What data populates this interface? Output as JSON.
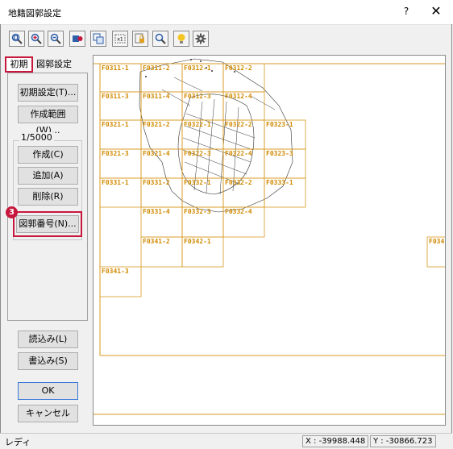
{
  "window": {
    "title": "地籍図郭設定",
    "help": "?",
    "close": "✕"
  },
  "toolbar": {
    "tools": [
      {
        "name": "zoom-extents-icon"
      },
      {
        "name": "zoom-in-icon"
      },
      {
        "name": "zoom-out-icon"
      },
      {
        "name": "layer-icon"
      },
      {
        "name": "copy-icon"
      },
      {
        "name": "scale-icon"
      },
      {
        "name": "lock-icon"
      },
      {
        "name": "find-icon"
      },
      {
        "name": "lightbulb-icon"
      },
      {
        "name": "gear-icon"
      }
    ]
  },
  "tabs": {
    "initial": "初期",
    "sheet": "図郭設定"
  },
  "buttons": {
    "initial_settings": "初期設定(T)...",
    "creation_range": "作成範囲(W)...",
    "create": "作成(C)",
    "add": "追加(A)",
    "delete": "削除(R)",
    "sheet_number": "図郭番号(N)...",
    "load": "読込み(L)",
    "save": "書込み(S)",
    "ok": "OK",
    "cancel": "キャンセル"
  },
  "scale_group": {
    "label": "1/5000"
  },
  "callout": {
    "number": "3"
  },
  "map": {
    "labels": [
      "F0311-1",
      "F0311-2",
      "F0312-1",
      "F0312-2",
      "F0311-3",
      "F0311-4",
      "F0312-3",
      "F0312-4",
      "F0321-1",
      "F0321-2",
      "F0322-1",
      "F0322-2",
      "F0323-1",
      "F0321-3",
      "F0321-4",
      "F0322-3",
      "F0322-4",
      "F0323-3",
      "F0331-1",
      "F0331-2",
      "F0332-1",
      "F0332-2",
      "F0333-1",
      "F0331-4",
      "F0332-3",
      "F0332-4",
      "F0341-2",
      "F0342-1",
      "F0341-3",
      "F034"
    ]
  },
  "status": {
    "text": "レディ",
    "x": "X : -39988.448",
    "y": "Y : -30866.723"
  },
  "colors": {
    "highlight": "#c8173d",
    "grid": "#d89a20",
    "label": "#d08a00"
  }
}
